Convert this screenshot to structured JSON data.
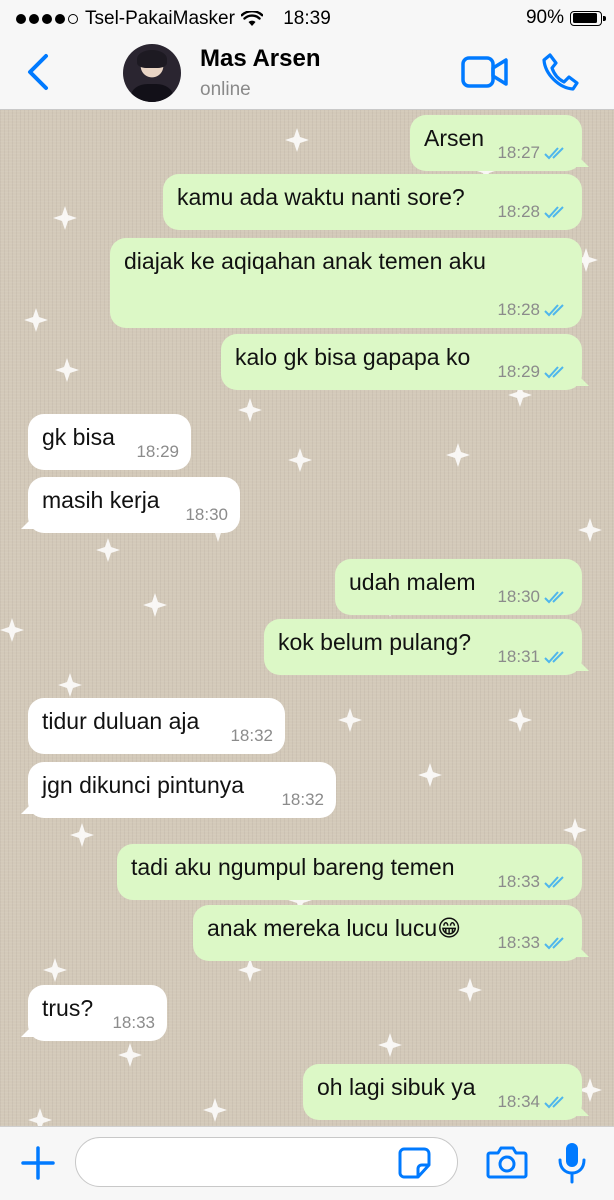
{
  "status_bar": {
    "carrier": "Tsel-PakaiMasker",
    "time": "18:39",
    "battery": "90%",
    "battery_level": 0.9,
    "signal_bars": 4,
    "signal_total": 5
  },
  "header": {
    "contact_name": "Mas Arsen",
    "contact_status": "online"
  },
  "messages": [
    {
      "dir": "out",
      "text": "Arsen",
      "time": "18:27",
      "read": true
    },
    {
      "dir": "out",
      "text": "kamu ada waktu nanti sore?",
      "time": "18:28",
      "read": true
    },
    {
      "dir": "out",
      "text": "diajak ke aqiqahan anak temen aku",
      "time": "18:28",
      "read": true
    },
    {
      "dir": "out",
      "text": "kalo gk bisa gapapa ko",
      "time": "18:29",
      "read": true
    },
    {
      "dir": "in",
      "text": "gk bisa",
      "time": "18:29"
    },
    {
      "dir": "in",
      "text": "masih kerja",
      "time": "18:30"
    },
    {
      "dir": "out",
      "text": "udah malem",
      "time": "18:30",
      "read": true
    },
    {
      "dir": "out",
      "text": "kok belum pulang?",
      "time": "18:31",
      "read": true
    },
    {
      "dir": "in",
      "text": "tidur duluan aja",
      "time": "18:32"
    },
    {
      "dir": "in",
      "text": "jgn dikunci pintunya",
      "time": "18:32"
    },
    {
      "dir": "out",
      "text": "tadi aku ngumpul bareng temen",
      "time": "18:33",
      "read": true
    },
    {
      "dir": "out",
      "text": "anak mereka lucu lucu😁",
      "time": "18:33",
      "read": true
    },
    {
      "dir": "in",
      "text": "trus?",
      "time": "18:33"
    },
    {
      "dir": "out",
      "text": "oh lagi sibuk ya",
      "time": "18:34",
      "read": true
    }
  ],
  "composer": {
    "placeholder": "",
    "value": ""
  },
  "colors": {
    "accent": "#007aff",
    "outgoing_bubble": "#dcf8c6",
    "incoming_bubble": "#ffffff",
    "read_ticks": "#4fb6ec",
    "wallpaper": "#d3c9b9"
  },
  "icons": {
    "back": "chevron-left-icon",
    "video": "video-camera-icon",
    "call": "phone-icon",
    "attach": "plus-icon",
    "sticker": "sticker-icon",
    "camera": "camera-icon",
    "mic": "microphone-icon",
    "wifi": "wifi-icon",
    "battery": "battery-icon"
  }
}
